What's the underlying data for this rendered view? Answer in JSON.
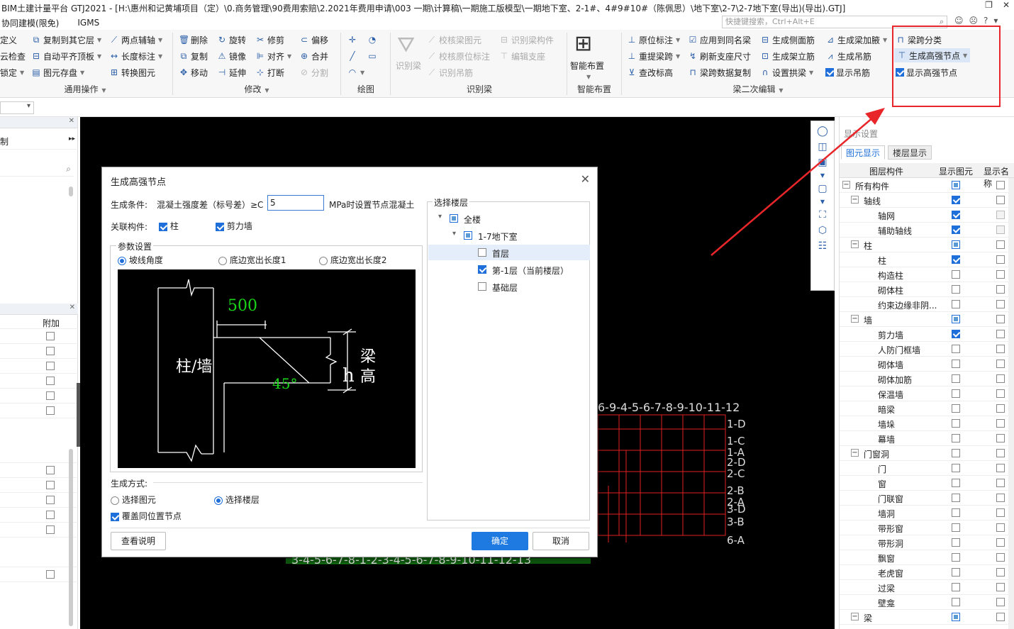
{
  "window": {
    "title": "BIM土建计量平台 GTJ2021 - [H:\\惠州和记黄埔项目（定）\\0.商务管理\\90费用索赔\\2.2021年费用申请\\003 一期\\计算稿\\一期施工版模型\\一期地下室、2-1#、4#9#10#（陈佩思）\\地下室\\2-7\\2-7地下室(导出)(导出).GTJ]",
    "restore_glyph": "❐",
    "close_glyph": "✕"
  },
  "menu": {
    "items": [
      "协同建模(限免)",
      "IGMS"
    ],
    "search_placeholder": "快捷键搜索，Ctrl+Alt+E"
  },
  "ribbon": {
    "common_ops": {
      "label": "通用操作",
      "col0": [
        "定义",
        "云检查",
        "锁定"
      ],
      "col1": [
        "复制到其它层",
        "自动平齐顶板",
        "图元存盘"
      ],
      "col2": [
        "两点辅轴",
        "长度标注",
        "转换图元"
      ]
    },
    "modify": {
      "label": "修改",
      "col1": [
        "删除",
        "复制",
        "移动"
      ],
      "col2": [
        "旋转",
        "镜像",
        "延伸"
      ],
      "col3": [
        "修剪",
        "对齐",
        "打断"
      ],
      "col4": [
        "偏移",
        "合并",
        "分割"
      ]
    },
    "draw": {
      "label": "绘图"
    },
    "identify_beam": {
      "label": "识别梁",
      "big": "识别梁",
      "col1": [
        "校核梁图元",
        "校核原位标注",
        "识别吊筋"
      ],
      "col2": [
        "识别梁构件",
        "编辑支座"
      ]
    },
    "smart_layout": {
      "label": "智能布置",
      "big": "智能布置"
    },
    "beam_secondary": {
      "label": "梁二次编辑",
      "col1": [
        "原位标注",
        "重提梁跨",
        "查改标高"
      ],
      "col2": [
        "应用到同名梁",
        "刷新支座尺寸",
        "梁跨数据复制"
      ],
      "col3": [
        "生成侧面筋",
        "生成架立筋",
        "设置拱梁"
      ],
      "col4": [
        "生成梁加腋",
        "生成吊筋",
        "显示吊筋"
      ]
    },
    "highlighted": {
      "span_class": "梁跨分类",
      "gen_strong_node": "生成高强节点",
      "show_strong_node": "显示高强节点"
    }
  },
  "left_panel": {
    "truncated_label": "制",
    "column_header": "附加"
  },
  "right_panel": {
    "title": "显示设置",
    "tabs": [
      "图元显示",
      "楼层显示"
    ],
    "headers": [
      "图层构件",
      "显示图元",
      "显示名称"
    ],
    "rows": [
      {
        "name": "所有构件",
        "level": 0,
        "toggle": "−",
        "show": "part",
        "name_show": "off"
      },
      {
        "name": "轴线",
        "level": 1,
        "toggle": "−",
        "show": "on",
        "name_show": "off"
      },
      {
        "name": "轴网",
        "level": 2,
        "toggle": "",
        "show": "on",
        "name_show": "dim"
      },
      {
        "name": "辅助轴线",
        "level": 2,
        "toggle": "",
        "show": "on",
        "name_show": "dim"
      },
      {
        "name": "柱",
        "level": 1,
        "toggle": "−",
        "show": "part",
        "name_show": "off"
      },
      {
        "name": "柱",
        "level": 2,
        "toggle": "",
        "show": "on",
        "name_show": "off"
      },
      {
        "name": "构造柱",
        "level": 2,
        "toggle": "",
        "show": "off",
        "name_show": "off"
      },
      {
        "name": "砌体柱",
        "level": 2,
        "toggle": "",
        "show": "off",
        "name_show": "off"
      },
      {
        "name": "约束边缘非阴...",
        "level": 2,
        "toggle": "",
        "show": "off",
        "name_show": "off"
      },
      {
        "name": "墙",
        "level": 1,
        "toggle": "−",
        "show": "part",
        "name_show": "off"
      },
      {
        "name": "剪力墙",
        "level": 2,
        "toggle": "",
        "show": "on",
        "name_show": "off"
      },
      {
        "name": "人防门框墙",
        "level": 2,
        "toggle": "",
        "show": "off",
        "name_show": "off"
      },
      {
        "name": "砌体墙",
        "level": 2,
        "toggle": "",
        "show": "off",
        "name_show": "off"
      },
      {
        "name": "砌体加筋",
        "level": 2,
        "toggle": "",
        "show": "off",
        "name_show": "off"
      },
      {
        "name": "保温墙",
        "level": 2,
        "toggle": "",
        "show": "off",
        "name_show": "off"
      },
      {
        "name": "暗梁",
        "level": 2,
        "toggle": "",
        "show": "off",
        "name_show": "off"
      },
      {
        "name": "墙垛",
        "level": 2,
        "toggle": "",
        "show": "off",
        "name_show": "off"
      },
      {
        "name": "幕墙",
        "level": 2,
        "toggle": "",
        "show": "off",
        "name_show": "off"
      },
      {
        "name": "门窗洞",
        "level": 1,
        "toggle": "−",
        "show": "off",
        "name_show": "off"
      },
      {
        "name": "门",
        "level": 2,
        "toggle": "",
        "show": "off",
        "name_show": "off"
      },
      {
        "name": "窗",
        "level": 2,
        "toggle": "",
        "show": "off",
        "name_show": "off"
      },
      {
        "name": "门联窗",
        "level": 2,
        "toggle": "",
        "show": "off",
        "name_show": "off"
      },
      {
        "name": "墙洞",
        "level": 2,
        "toggle": "",
        "show": "off",
        "name_show": "off"
      },
      {
        "name": "带形窗",
        "level": 2,
        "toggle": "",
        "show": "off",
        "name_show": "off"
      },
      {
        "name": "带形洞",
        "level": 2,
        "toggle": "",
        "show": "off",
        "name_show": "off"
      },
      {
        "name": "飘窗",
        "level": 2,
        "toggle": "",
        "show": "off",
        "name_show": "off"
      },
      {
        "name": "老虎窗",
        "level": 2,
        "toggle": "",
        "show": "off",
        "name_show": "off"
      },
      {
        "name": "过梁",
        "level": 2,
        "toggle": "",
        "show": "off",
        "name_show": "off"
      },
      {
        "name": "壁龛",
        "level": 2,
        "toggle": "",
        "show": "off",
        "name_show": "off"
      },
      {
        "name": "梁",
        "level": 1,
        "toggle": "−",
        "show": "part",
        "name_show": "off"
      }
    ]
  },
  "canvas": {
    "axis_top": "6-9-4-5-6-7-8-9-10-11-12",
    "axis_bottom": "3-4-5-6-7-8-1-2-3-4-5-6-7-8-9-10-11-12-13",
    "axis_right": [
      "1-D",
      "1-C",
      "1-A",
      "2-D",
      "2-C",
      "2-B",
      "2-A",
      "3-D",
      "3-B",
      "6-A"
    ]
  },
  "dialog": {
    "title": "生成高强节点",
    "cond_label": "生成条件:",
    "cond_text": "混凝土强度差（标号差）≥C",
    "cond_value": "5",
    "cond_suffix": "MPa时设置节点混凝土",
    "related_label": "关联构件:",
    "related": [
      {
        "label": "柱",
        "checked": true
      },
      {
        "label": "剪力墙",
        "checked": true
      }
    ],
    "param_title": "参数设置",
    "param_options": [
      {
        "label": "坡线角度",
        "selected": true
      },
      {
        "label": "底边宽出长度1",
        "selected": false
      },
      {
        "label": "底边宽出长度2",
        "selected": false
      }
    ],
    "diagram": {
      "dim_500": "500",
      "angle": "45°",
      "col_wall": "柱/墙",
      "h": "h",
      "beam_h1": "梁",
      "beam_h2": "高"
    },
    "gen_method_label": "生成方式:",
    "gen_methods": [
      {
        "label": "选择图元",
        "selected": false
      },
      {
        "label": "选择楼层",
        "selected": true
      }
    ],
    "overwrite_label": "覆盖同位置节点",
    "overwrite_checked": true,
    "floor_title": "选择楼层",
    "floors": [
      {
        "label": "全楼",
        "level": 0,
        "state": "part",
        "toggle": "▾"
      },
      {
        "label": "1-7地下室",
        "level": 1,
        "state": "part",
        "toggle": "▾"
      },
      {
        "label": "首层",
        "level": 2,
        "state": "off",
        "toggle": ""
      },
      {
        "label": "第-1层（当前楼层）",
        "level": 2,
        "state": "on",
        "toggle": ""
      },
      {
        "label": "基础层",
        "level": 2,
        "state": "off",
        "toggle": ""
      }
    ],
    "help_button": "查看说明",
    "ok_button": "确定",
    "cancel_button": "取消"
  },
  "colors": {
    "highlight_red": "#e8262a",
    "accent_blue": "#1e6fd9",
    "diagram_green": "#19d419"
  }
}
